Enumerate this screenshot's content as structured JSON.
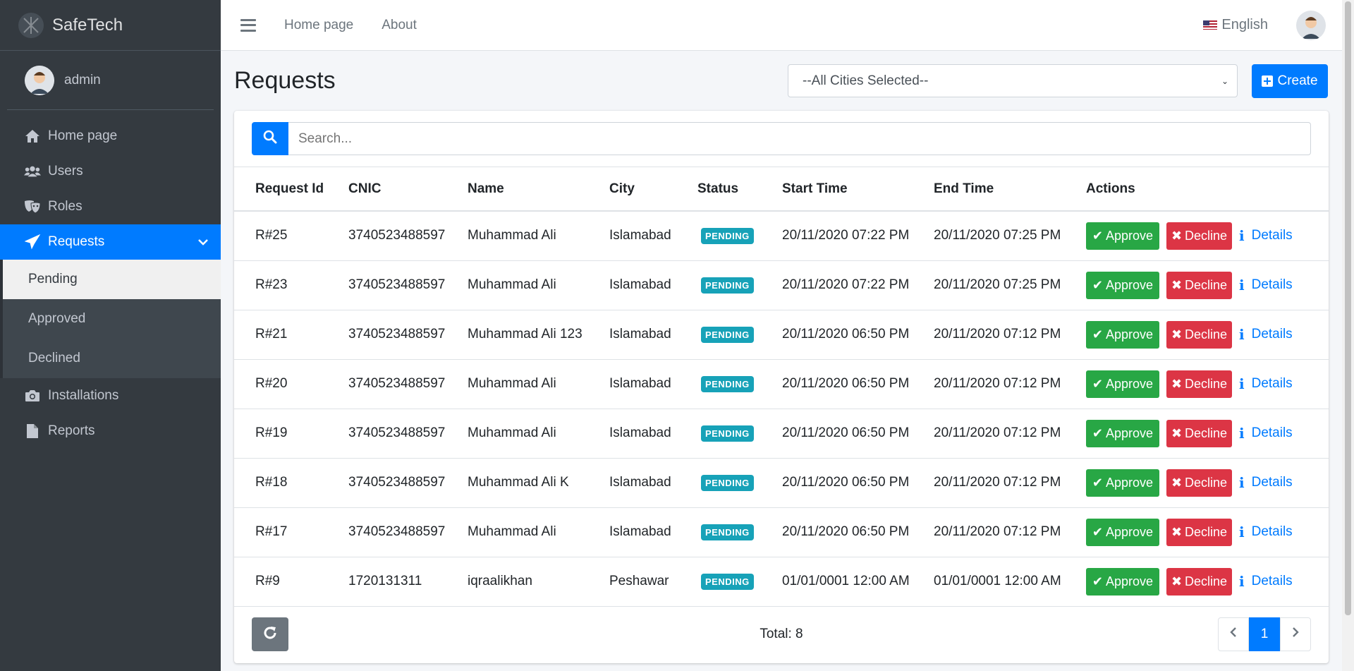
{
  "brand": {
    "name": "SafeTech"
  },
  "user": {
    "name": "admin"
  },
  "sidebar": {
    "items": [
      {
        "label": "Home page",
        "icon": "home-icon"
      },
      {
        "label": "Users",
        "icon": "users-icon"
      },
      {
        "label": "Roles",
        "icon": "masks-icon"
      },
      {
        "label": "Requests",
        "icon": "paper-plane-icon",
        "active": true
      },
      {
        "label": "Installations",
        "icon": "camera-icon"
      },
      {
        "label": "Reports",
        "icon": "file-icon"
      }
    ],
    "submenu": [
      {
        "label": "Pending",
        "current": true
      },
      {
        "label": "Approved"
      },
      {
        "label": "Declined"
      }
    ]
  },
  "navbar": {
    "links": [
      "Home page",
      "About"
    ],
    "language": "English"
  },
  "page": {
    "title": "Requests",
    "city_select": "--All Cities Selected--",
    "create_label": "Create",
    "search_placeholder": "Search..."
  },
  "table": {
    "columns": [
      "Request Id",
      "CNIC",
      "Name",
      "City",
      "Status",
      "Start Time",
      "End Time",
      "Actions"
    ],
    "rows": [
      {
        "id": "R#25",
        "cnic": "3740523488597",
        "name": "Muhammad Ali",
        "city": "Islamabad",
        "status": "PENDING",
        "start": "20/11/2020 07:22 PM",
        "end": "20/11/2020 07:25 PM"
      },
      {
        "id": "R#23",
        "cnic": "3740523488597",
        "name": "Muhammad Ali",
        "city": "Islamabad",
        "status": "PENDING",
        "start": "20/11/2020 07:22 PM",
        "end": "20/11/2020 07:25 PM"
      },
      {
        "id": "R#21",
        "cnic": "3740523488597",
        "name": "Muhammad Ali 123",
        "city": "Islamabad",
        "status": "PENDING",
        "start": "20/11/2020 06:50 PM",
        "end": "20/11/2020 07:12 PM"
      },
      {
        "id": "R#20",
        "cnic": "3740523488597",
        "name": "Muhammad Ali",
        "city": "Islamabad",
        "status": "PENDING",
        "start": "20/11/2020 06:50 PM",
        "end": "20/11/2020 07:12 PM"
      },
      {
        "id": "R#19",
        "cnic": "3740523488597",
        "name": "Muhammad Ali",
        "city": "Islamabad",
        "status": "PENDING",
        "start": "20/11/2020 06:50 PM",
        "end": "20/11/2020 07:12 PM"
      },
      {
        "id": "R#18",
        "cnic": "3740523488597",
        "name": "Muhammad Ali K",
        "city": "Islamabad",
        "status": "PENDING",
        "start": "20/11/2020 06:50 PM",
        "end": "20/11/2020 07:12 PM"
      },
      {
        "id": "R#17",
        "cnic": "3740523488597",
        "name": "Muhammad Ali",
        "city": "Islamabad",
        "status": "PENDING",
        "start": "20/11/2020 06:50 PM",
        "end": "20/11/2020 07:12 PM"
      },
      {
        "id": "R#9",
        "cnic": "1720131311",
        "name": "iqraalikhan",
        "city": "Peshawar",
        "status": "PENDING",
        "start": "01/01/0001 12:00 AM",
        "end": "01/01/0001 12:00 AM"
      }
    ],
    "actions": {
      "approve": "Approve",
      "decline": "Decline",
      "details": "Details"
    }
  },
  "footer": {
    "total": "Total: 8",
    "current_page": "1"
  },
  "colors": {
    "primary": "#007bff",
    "success": "#28a745",
    "danger": "#dc3545",
    "info": "#17a2b8",
    "sidebar": "#343a40"
  }
}
